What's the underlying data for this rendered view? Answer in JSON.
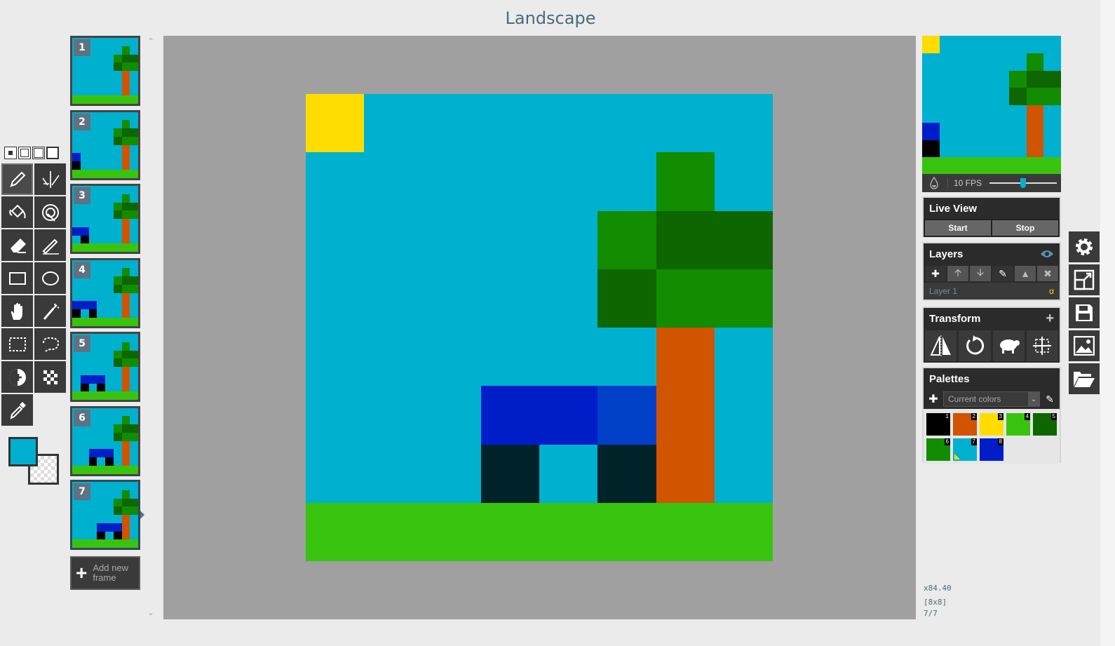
{
  "app": {
    "title": "Landscape"
  },
  "colors": {
    "sky": "#00b0cf",
    "sun": "#ffdd00",
    "ground": "#38c40e",
    "trunk": "#d15401",
    "leaf_light": "#128c00",
    "leaf_dark": "#0d6600",
    "body_blue": "#001ec8",
    "body_blue2": "#0040c8",
    "legs": "#00232a",
    "primary": "#00b0cf"
  },
  "toolbox": {
    "pen_sizes": [
      "1",
      "2",
      "3",
      "4"
    ],
    "tools": [
      {
        "name": "pen-tool",
        "icon": "pencil-icon"
      },
      {
        "name": "vertical-mirror-pen-tool",
        "icon": "mirror-pen-icon"
      },
      {
        "name": "paint-bucket-tool",
        "icon": "bucket-icon"
      },
      {
        "name": "paint-all-same-pixels-tool",
        "icon": "magic-bucket-icon"
      },
      {
        "name": "eraser-tool",
        "icon": "eraser-icon"
      },
      {
        "name": "stroke-tool",
        "icon": "stroke-icon"
      },
      {
        "name": "rectangle-tool",
        "icon": "rectangle-icon"
      },
      {
        "name": "circle-tool",
        "icon": "circle-icon"
      },
      {
        "name": "move-tool",
        "icon": "hand-icon"
      },
      {
        "name": "shape-selection-tool",
        "icon": "magic-wand-icon"
      },
      {
        "name": "rectangle-selection-tool",
        "icon": "rect-select-icon"
      },
      {
        "name": "lasso-selection-tool",
        "icon": "lasso-icon"
      },
      {
        "name": "lighten-tool",
        "icon": "lighten-icon"
      },
      {
        "name": "dithering-tool",
        "icon": "checker-icon"
      },
      {
        "name": "color-picker-tool",
        "icon": "eyedropper-icon"
      }
    ]
  },
  "frames": [
    {
      "num": "1"
    },
    {
      "num": "2"
    },
    {
      "num": "3"
    },
    {
      "num": "4"
    },
    {
      "num": "5"
    },
    {
      "num": "6"
    },
    {
      "num": "7"
    }
  ],
  "add_frame": {
    "label": "Add new frame"
  },
  "preview": {
    "fps_label": "10 FPS",
    "fps_fraction": 0.5
  },
  "live_view": {
    "title": "Live View",
    "start": "Start",
    "stop": "Stop"
  },
  "layers": {
    "title": "Layers",
    "items": [
      {
        "name": "Layer 1",
        "alpha": "α"
      }
    ]
  },
  "transform": {
    "title": "Transform",
    "icons": [
      "flip-icon",
      "rotate-icon",
      "clone-icon",
      "center-icon"
    ]
  },
  "palettes": {
    "title": "Palettes",
    "selected": "Current colors",
    "swatches": [
      {
        "n": "1",
        "color": "#000000"
      },
      {
        "n": "2",
        "color": "#d15401"
      },
      {
        "n": "3",
        "color": "#ffdd00"
      },
      {
        "n": "4",
        "color": "#38c40e"
      },
      {
        "n": "5",
        "color": "#0d6600"
      },
      {
        "n": "6",
        "color": "#128c00"
      },
      {
        "n": "7",
        "color": "#00b0cf"
      },
      {
        "n": "8",
        "color": "#001ec8"
      }
    ]
  },
  "side_buttons": [
    "gear-icon",
    "resize-icon",
    "save-icon",
    "export-image-icon",
    "open-folder-icon"
  ],
  "status": {
    "zoom": "x84.40",
    "size": "[8x8]",
    "frame": "7/7"
  }
}
